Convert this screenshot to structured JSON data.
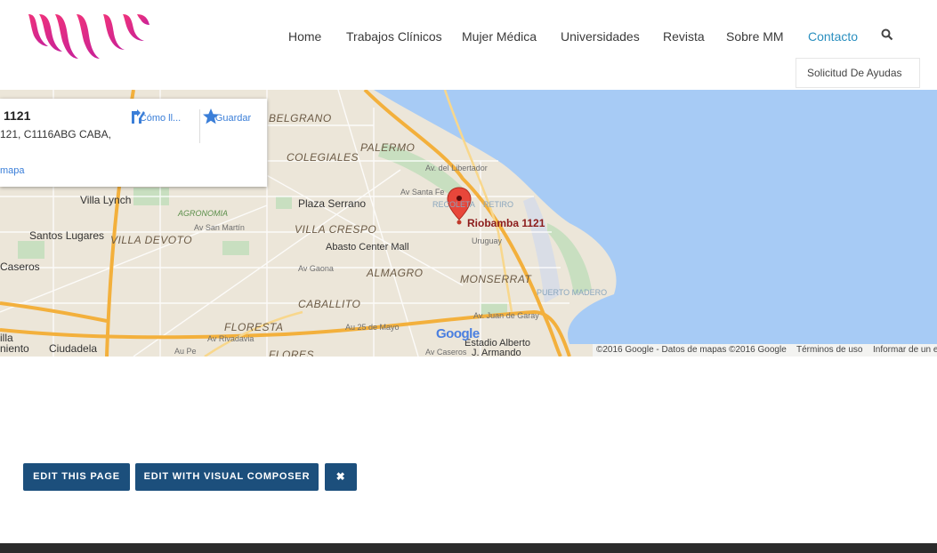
{
  "colors": {
    "brand_gradient_start": "#ee2a7b",
    "brand_gradient_end": "#c8229a",
    "nav_active": "#2a8fbf",
    "edit_button_bg": "#1c4f7c",
    "map_water": "#a7cbf5",
    "map_land": "#ece6d9",
    "map_highway": "#f3b03c",
    "footer_bar": "#2b2b2b"
  },
  "header": {
    "logo_icon": "brand-logo-icon",
    "nav": [
      {
        "label": "Home",
        "active": false
      },
      {
        "label": "Trabajos Clínicos",
        "active": false
      },
      {
        "label": "Mujer Médica",
        "active": false
      },
      {
        "label": "Universidades",
        "active": false
      },
      {
        "label": "Revista",
        "active": false
      },
      {
        "label": "Sobre MM",
        "active": false
      },
      {
        "label": "Contacto",
        "active": true
      }
    ],
    "search_icon": "search-icon",
    "submenu_item": "Solicitud De Ayudas"
  },
  "map": {
    "info_card": {
      "title": "1121",
      "address": "121, C1116ABG CABA,",
      "link": "mapa",
      "directions_label": "Cómo ll...",
      "save_label": "Guardar",
      "directions_icon": "directions-icon",
      "save_icon": "star-icon"
    },
    "marker_label": "Riobamba 1121",
    "labels": {
      "belgrano": "BELGRANO",
      "palermo": "PALERMO",
      "colegiales": "COLEGIALES",
      "villa_lynch": "Villa Lynch",
      "plaza_serrano": "Plaza Serrano",
      "santos_lugares": "Santos Lugares",
      "villa_devoto": "VILLA DEVOTO",
      "villa_crespo": "VILLA CRESPO",
      "abasto": "Abasto Center Mall",
      "caseros": "Caseros",
      "almagro": "ALMAGRO",
      "monserrat": "MONSERRAT",
      "caballito": "CABALLITO",
      "floresta": "FLORESTA",
      "ciudadela": "Ciudadela",
      "flores": "FLORES",
      "estadio": "Estadio Alberto",
      "estadio2": "J. Armando",
      "agronomia": "AGRONOMIA",
      "puerto_madero": "PUERTO MADERO",
      "recoleta": "RECOLETA",
      "retiro": "RETIRO",
      "au25": "Au 25 de Mayo",
      "av_san_martin": "Av San Martín",
      "av_rivadavia": "Av Rivadavia",
      "av_gaona": "Av Gaona",
      "av_santa_fe": "Av Santa Fe",
      "av_libertador": "Av. del Libertador",
      "av_juan_de_garay": "Av. Juan de Garay",
      "av_caseros": "Av Caseros",
      "uruguay": "Uruguay",
      "av_pe": "Au Pe",
      "illa": "illa",
      "niento": "niento"
    },
    "google_logo": "Google",
    "footer": {
      "attribution": "©2016 Google - Datos de mapas ©2016 Google",
      "terms": "Términos de uso",
      "report": "Informar de un e"
    }
  },
  "admin": {
    "edit_page": "EDIT THIS PAGE",
    "edit_composer": "EDIT WITH VISUAL COMPOSER",
    "close_icon": "close-icon",
    "close_glyph": "✖"
  }
}
